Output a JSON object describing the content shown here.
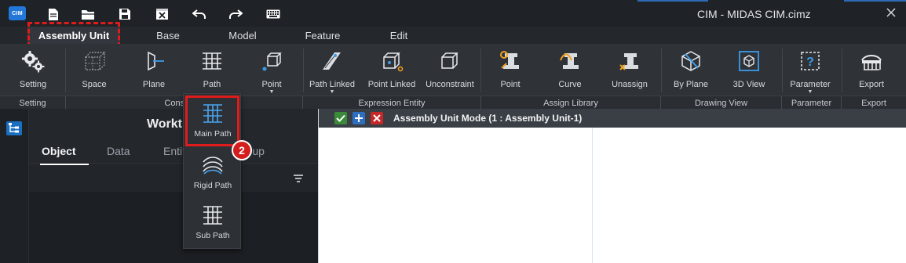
{
  "app": {
    "logo_text": "CIM",
    "window_title": "CIM - MIDAS CIM.cimz"
  },
  "quick_access": [
    "new-file-icon",
    "open-folder-icon",
    "save-icon",
    "close-file-icon",
    "undo-icon",
    "redo-icon",
    "keyboard-icon"
  ],
  "tabs": [
    {
      "label": "Assembly Unit",
      "active": true
    },
    {
      "label": "Base",
      "active": false
    },
    {
      "label": "Model",
      "active": false
    },
    {
      "label": "Feature",
      "active": false
    },
    {
      "label": "Edit",
      "active": false
    }
  ],
  "ribbon": {
    "buttons": [
      {
        "label": "Setting",
        "icon": "gears-icon"
      },
      {
        "label": "Space",
        "icon": "space-cube-icon"
      },
      {
        "label": "Plane",
        "icon": "plane-icon"
      },
      {
        "label": "Path",
        "icon": "path-icon",
        "dropdown": true
      },
      {
        "label": "Point",
        "icon": "point-cube-icon",
        "dropdown": true
      },
      {
        "label": "Path Linked",
        "icon": "path-linked-icon",
        "dropdown": true
      },
      {
        "label": "Point Linked",
        "icon": "point-linked-icon"
      },
      {
        "label": "Unconstraint",
        "icon": "unconstraint-cube-icon"
      },
      {
        "label": "Point",
        "icon": "assign-point-icon"
      },
      {
        "label": "Curve",
        "icon": "assign-curve-icon"
      },
      {
        "label": "Unassign",
        "icon": "unassign-icon"
      },
      {
        "label": "By Plane",
        "icon": "by-plane-icon"
      },
      {
        "label": "3D View",
        "icon": "3d-view-icon"
      },
      {
        "label": "Parameter",
        "icon": "parameter-icon",
        "dropdown": true
      },
      {
        "label": "Export",
        "icon": "export-icon"
      }
    ],
    "groups": [
      "Setting",
      "Constraint",
      "Expression Entity",
      "Assign Library",
      "Drawing View",
      "Parameter",
      "Export"
    ]
  },
  "path_dropdown": {
    "items": [
      {
        "label": "Main Path",
        "icon": "main-path-icon",
        "highlighted": true
      },
      {
        "label": "Rigid Path",
        "icon": "rigid-path-icon"
      },
      {
        "label": "Sub Path",
        "icon": "sub-path-icon"
      }
    ],
    "step_number": "2"
  },
  "work_tree": {
    "title": "Worktree",
    "tabs": [
      {
        "label": "Object",
        "active": true
      },
      {
        "label": "Data",
        "active": false
      },
      {
        "label": "Entity",
        "active": false
      },
      {
        "label": "Group",
        "active": false
      }
    ]
  },
  "viewport": {
    "mode_text": "Assembly Unit Mode (1 : Assembly Unit-1)",
    "colors": {
      "confirm": "#3a8a3a",
      "add": "#2f6fbf",
      "cancel": "#c62828"
    }
  },
  "colors": {
    "accent_blue": "#1b6fc1",
    "annotation_red": "#e01b1b",
    "ribbon_bg": "#2f3338"
  }
}
